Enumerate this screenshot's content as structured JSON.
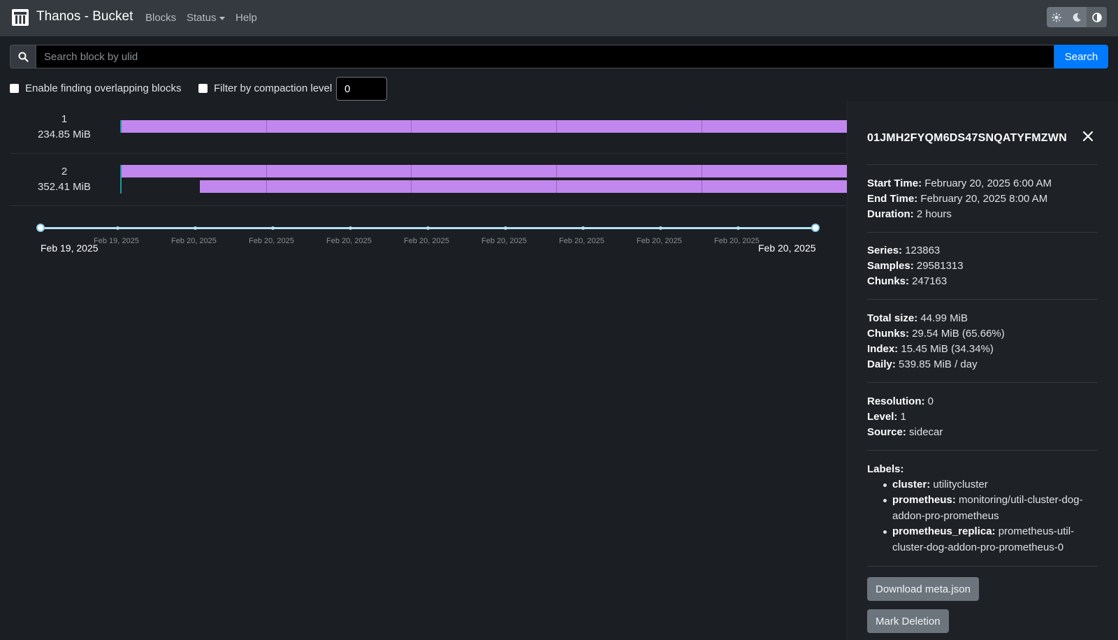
{
  "nav": {
    "brand": "Thanos - Bucket",
    "links": {
      "blocks": "Blocks",
      "status": "Status",
      "help": "Help"
    },
    "theme_buttons": [
      "light-theme",
      "dark-theme",
      "auto-theme"
    ]
  },
  "search": {
    "placeholder": "Search block by ulid",
    "button": "Search"
  },
  "filters": {
    "overlap_label": "Enable finding overlapping blocks",
    "overlap_checked": false,
    "compaction_label": "Filter by compaction level",
    "compaction_checked": false,
    "compaction_value": "0"
  },
  "rows": [
    {
      "level": "1",
      "size": "234.85 MiB"
    },
    {
      "level": "2",
      "size": "352.41 MiB"
    }
  ],
  "timeline": {
    "start_label": "Feb 19, 2025",
    "end_label": "Feb 20, 2025",
    "ticks": [
      "Feb 19, 2025",
      "Feb 20, 2025",
      "Feb 20, 2025",
      "Feb 20, 2025",
      "Feb 20, 2025",
      "Feb 20, 2025",
      "Feb 20, 2025",
      "Feb 20, 2025",
      "Feb 20, 2025"
    ]
  },
  "detail": {
    "ulid": "01JMH2FYQM6DS47SNQATYFMZWN",
    "time": {
      "start_k": "Start Time:",
      "start_v": "February 20, 2025 6:00 AM",
      "end_k": "End Time:",
      "end_v": "February 20, 2025 8:00 AM",
      "duration_k": "Duration:",
      "duration_v": "2 hours"
    },
    "stats": {
      "series_k": "Series:",
      "series_v": "123863",
      "samples_k": "Samples:",
      "samples_v": "29581313",
      "chunks_k": "Chunks:",
      "chunks_v": "247163"
    },
    "size": {
      "total_k": "Total size:",
      "total_v": "44.99 MiB",
      "chunks_k": "Chunks:",
      "chunks_v": "29.54 MiB (65.66%)",
      "index_k": "Index:",
      "index_v": "15.45 MiB (34.34%)",
      "daily_k": "Daily:",
      "daily_v": "539.85 MiB / day"
    },
    "meta": {
      "resolution_k": "Resolution:",
      "resolution_v": "0",
      "level_k": "Level:",
      "level_v": "1",
      "source_k": "Source:",
      "source_v": "sidecar"
    },
    "labels_title": "Labels:",
    "labels": [
      {
        "k": "cluster:",
        "v": "utilitycluster"
      },
      {
        "k": "prometheus:",
        "v": "monitoring/util-cluster-dog-addon-pro-prometheus"
      },
      {
        "k": "prometheus_replica:",
        "v": "prometheus-util-cluster-dog-addon-pro-prometheus-0"
      }
    ],
    "download_button": "Download meta.json",
    "delete_button": "Mark Deletion"
  },
  "colors": {
    "accent": "#007bff",
    "block": "#c287ee",
    "navbar": "#343a40",
    "background": "#1b1e23"
  }
}
